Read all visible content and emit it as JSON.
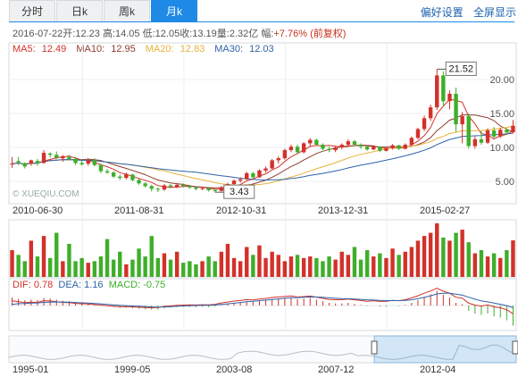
{
  "tabs": [
    {
      "label": "分时",
      "active": false
    },
    {
      "label": "日k",
      "active": false
    },
    {
      "label": "周k",
      "active": false
    },
    {
      "label": "月k",
      "active": true
    }
  ],
  "top_links": {
    "prefs": "偏好设置",
    "fullscreen": "全屏显示"
  },
  "info_bar": {
    "date": "2016-07-22",
    "open_label": "开:",
    "open": "12.23",
    "high_label": "高:",
    "high": "14.05",
    "low_label": "低:",
    "low": "12.05",
    "close_label": "收:",
    "close": "13.19",
    "volume_label": "量:",
    "volume": "2.32亿",
    "change_label": "幅:",
    "change": "+7.76%",
    "adjust": "(前复权)"
  },
  "ma_legend": [
    {
      "label": "MA5:",
      "value": "12.49",
      "color": "#d3312a"
    },
    {
      "label": "MA10:",
      "value": "12.95",
      "color": "#8e3b2e"
    },
    {
      "label": "MA20:",
      "value": "12.83",
      "color": "#e8b23a"
    },
    {
      "label": "MA30:",
      "value": "12.03",
      "color": "#2f63a8"
    }
  ],
  "watermark": "© XUEQIU.COM",
  "price_axis": [
    "20.00",
    "15.00",
    "10.00",
    "5.00"
  ],
  "callouts": {
    "max": "21.52",
    "min": "3.43"
  },
  "date_axis": [
    "2010-06-30",
    "2011-08-31",
    "2012-10-31",
    "2013-12-31",
    "2015-02-27"
  ],
  "macd_legend": {
    "dif_label": "DIF:",
    "dif": "0.78",
    "dea_label": "DEA:",
    "dea": "1.16",
    "macd_label": "MACD:",
    "macd": "-0.75"
  },
  "navigator_axis": [
    "1995-01",
    "1999-05",
    "2003-08",
    "2007-12",
    "2012-04"
  ],
  "colors": {
    "up": "#d3312a",
    "down": "#3fae2a",
    "accent": "#1e8ae6"
  },
  "chart_data": {
    "type": "candlestick",
    "period": "monthly",
    "ohlc": [
      [
        7.5,
        8.6,
        7.0,
        7.6
      ],
      [
        8.0,
        8.6,
        7.4,
        7.8
      ],
      [
        7.7,
        7.8,
        6.9,
        7.2
      ],
      [
        7.6,
        8.2,
        7.3,
        8.1
      ],
      [
        8.0,
        8.3,
        7.3,
        7.7
      ],
      [
        7.7,
        9.6,
        7.6,
        9.2
      ],
      [
        9.1,
        9.3,
        8.5,
        8.9
      ],
      [
        8.9,
        9.4,
        8.3,
        8.5
      ],
      [
        8.4,
        8.9,
        7.9,
        8.7
      ],
      [
        8.6,
        8.9,
        8.1,
        8.3
      ],
      [
        8.3,
        8.6,
        7.4,
        7.7
      ],
      [
        7.7,
        8.1,
        7.3,
        7.5
      ],
      [
        7.6,
        8.4,
        7.3,
        8.1
      ],
      [
        8.1,
        8.4,
        7.2,
        7.4
      ],
      [
        7.4,
        7.6,
        6.2,
        6.5
      ],
      [
        6.5,
        6.8,
        6.1,
        6.3
      ],
      [
        6.3,
        6.5,
        5.5,
        5.7
      ],
      [
        5.7,
        6.0,
        5.2,
        5.5
      ],
      [
        5.5,
        6.3,
        5.3,
        6.1
      ],
      [
        6.0,
        6.1,
        5.0,
        5.2
      ],
      [
        5.2,
        5.4,
        4.5,
        4.7
      ],
      [
        4.7,
        4.9,
        4.1,
        4.3
      ],
      [
        4.3,
        4.5,
        3.5,
        3.9
      ],
      [
        3.9,
        4.1,
        3.43,
        3.8
      ],
      [
        3.8,
        4.6,
        3.6,
        4.4
      ],
      [
        4.4,
        4.6,
        4.0,
        4.2
      ],
      [
        4.2,
        4.7,
        4.0,
        4.5
      ],
      [
        4.5,
        4.7,
        4.1,
        4.3
      ],
      [
        4.3,
        4.5,
        3.9,
        4.1
      ],
      [
        4.1,
        4.3,
        3.7,
        3.9
      ],
      [
        3.9,
        4.2,
        3.7,
        4.0
      ],
      [
        4.0,
        4.1,
        3.5,
        3.7
      ],
      [
        3.7,
        3.9,
        3.4,
        3.6
      ],
      [
        3.6,
        4.3,
        3.5,
        4.1
      ],
      [
        4.1,
        4.8,
        4.0,
        4.6
      ],
      [
        4.6,
        5.3,
        4.5,
        5.1
      ],
      [
        5.1,
        5.6,
        4.8,
        5.3
      ],
      [
        5.3,
        6.4,
        5.2,
        6.2
      ],
      [
        6.2,
        6.4,
        5.4,
        5.6
      ],
      [
        5.6,
        6.8,
        5.5,
        6.6
      ],
      [
        6.6,
        7.2,
        6.3,
        6.9
      ],
      [
        6.9,
        8.3,
        6.8,
        8.1
      ],
      [
        8.1,
        8.7,
        7.6,
        8.4
      ],
      [
        8.4,
        9.8,
        8.2,
        9.6
      ],
      [
        9.6,
        10.4,
        9.3,
        10.1
      ],
      [
        10.1,
        10.4,
        9.0,
        9.3
      ],
      [
        9.3,
        10.8,
        9.1,
        10.6
      ],
      [
        10.6,
        11.4,
        10.2,
        11.1
      ],
      [
        11.1,
        11.3,
        10.2,
        10.4
      ],
      [
        10.4,
        10.6,
        9.6,
        9.8
      ],
      [
        9.8,
        10.1,
        9.3,
        9.6
      ],
      [
        9.6,
        10.2,
        9.3,
        10.0
      ],
      [
        10.0,
        10.6,
        9.7,
        10.4
      ],
      [
        10.4,
        11.2,
        10.1,
        10.9
      ],
      [
        10.9,
        11.1,
        10.2,
        10.4
      ],
      [
        10.4,
        10.6,
        9.8,
        10.1
      ],
      [
        10.1,
        10.3,
        9.5,
        9.7
      ],
      [
        9.7,
        10.3,
        9.6,
        10.1
      ],
      [
        10.1,
        10.2,
        9.3,
        9.5
      ],
      [
        9.5,
        10.1,
        9.4,
        9.9
      ],
      [
        9.9,
        10.5,
        9.7,
        10.3
      ],
      [
        10.3,
        10.4,
        9.6,
        9.8
      ],
      [
        9.8,
        10.6,
        9.7,
        10.4
      ],
      [
        10.4,
        11.6,
        10.2,
        11.4
      ],
      [
        11.4,
        12.9,
        11.2,
        12.7
      ],
      [
        12.7,
        14.7,
        12.4,
        14.3
      ],
      [
        14.3,
        16.3,
        13.9,
        15.9
      ],
      [
        15.9,
        21.52,
        15.5,
        20.6
      ],
      [
        20.6,
        21.2,
        16.1,
        16.8
      ],
      [
        16.8,
        18.4,
        15.6,
        17.9
      ],
      [
        17.9,
        18.8,
        12.3,
        13.4
      ],
      [
        13.4,
        15.2,
        10.6,
        14.6
      ],
      [
        14.6,
        15.0,
        9.8,
        10.2
      ],
      [
        10.2,
        11.6,
        9.8,
        11.2
      ],
      [
        11.2,
        12.4,
        10.4,
        10.7
      ],
      [
        10.7,
        12.8,
        10.5,
        12.5
      ],
      [
        12.5,
        13.0,
        11.3,
        11.6
      ],
      [
        11.6,
        12.9,
        11.4,
        12.6
      ],
      [
        12.6,
        12.8,
        11.9,
        12.2
      ],
      [
        12.23,
        14.05,
        12.05,
        13.19
      ]
    ],
    "volume": [
      1.7,
      1.4,
      1.0,
      2.3,
      1.3,
      2.6,
      1.2,
      2.8,
      1.0,
      2.1,
      1.0,
      1.2,
      0.9,
      1.0,
      1.3,
      2.4,
      1.1,
      1.6,
      0.8,
      1.1,
      1.8,
      1.3,
      2.6,
      1.2,
      1.5,
      1.1,
      1.6,
      0.9,
      1.0,
      0.8,
      1.0,
      1.3,
      1.0,
      1.6,
      2.1,
      1.2,
      1.0,
      1.9,
      1.4,
      2.0,
      1.2,
      1.6,
      1.4,
      1.0,
      1.3,
      1.4,
      1.2,
      1.3,
      1.2,
      1.0,
      1.3,
      1.1,
      1.6,
      1.4,
      1.9,
      1.1,
      1.7,
      1.3,
      1.5,
      1.2,
      1.8,
      1.4,
      1.6,
      1.9,
      2.3,
      2.6,
      2.8,
      3.4,
      2.5,
      2.3,
      2.8,
      3.0,
      2.2,
      1.5,
      1.7,
      1.3,
      1.5,
      1.2,
      1.7,
      2.32
    ],
    "macd_hist": [
      0.3,
      0.25,
      0.2,
      0.22,
      0.2,
      0.28,
      0.26,
      0.22,
      0.18,
      0.16,
      0.12,
      0.1,
      0.08,
      0.05,
      0.02,
      -0.02,
      -0.05,
      -0.08,
      -0.08,
      -0.1,
      -0.12,
      -0.14,
      -0.16,
      -0.15,
      -0.1,
      -0.08,
      -0.06,
      -0.05,
      -0.05,
      -0.06,
      -0.05,
      -0.06,
      -0.04,
      0.02,
      0.06,
      0.1,
      0.12,
      0.16,
      0.14,
      0.18,
      0.2,
      0.24,
      0.26,
      0.28,
      0.3,
      0.24,
      0.26,
      0.28,
      0.22,
      0.16,
      0.1,
      0.08,
      0.08,
      0.1,
      0.06,
      0.02,
      -0.02,
      0.0,
      -0.04,
      -0.04,
      0.0,
      -0.02,
      0.02,
      0.1,
      0.2,
      0.32,
      0.42,
      0.55,
      0.4,
      0.3,
      0.1,
      0.05,
      -0.2,
      -0.3,
      -0.35,
      -0.3,
      -0.4,
      -0.45,
      -0.55,
      -0.75
    ]
  }
}
